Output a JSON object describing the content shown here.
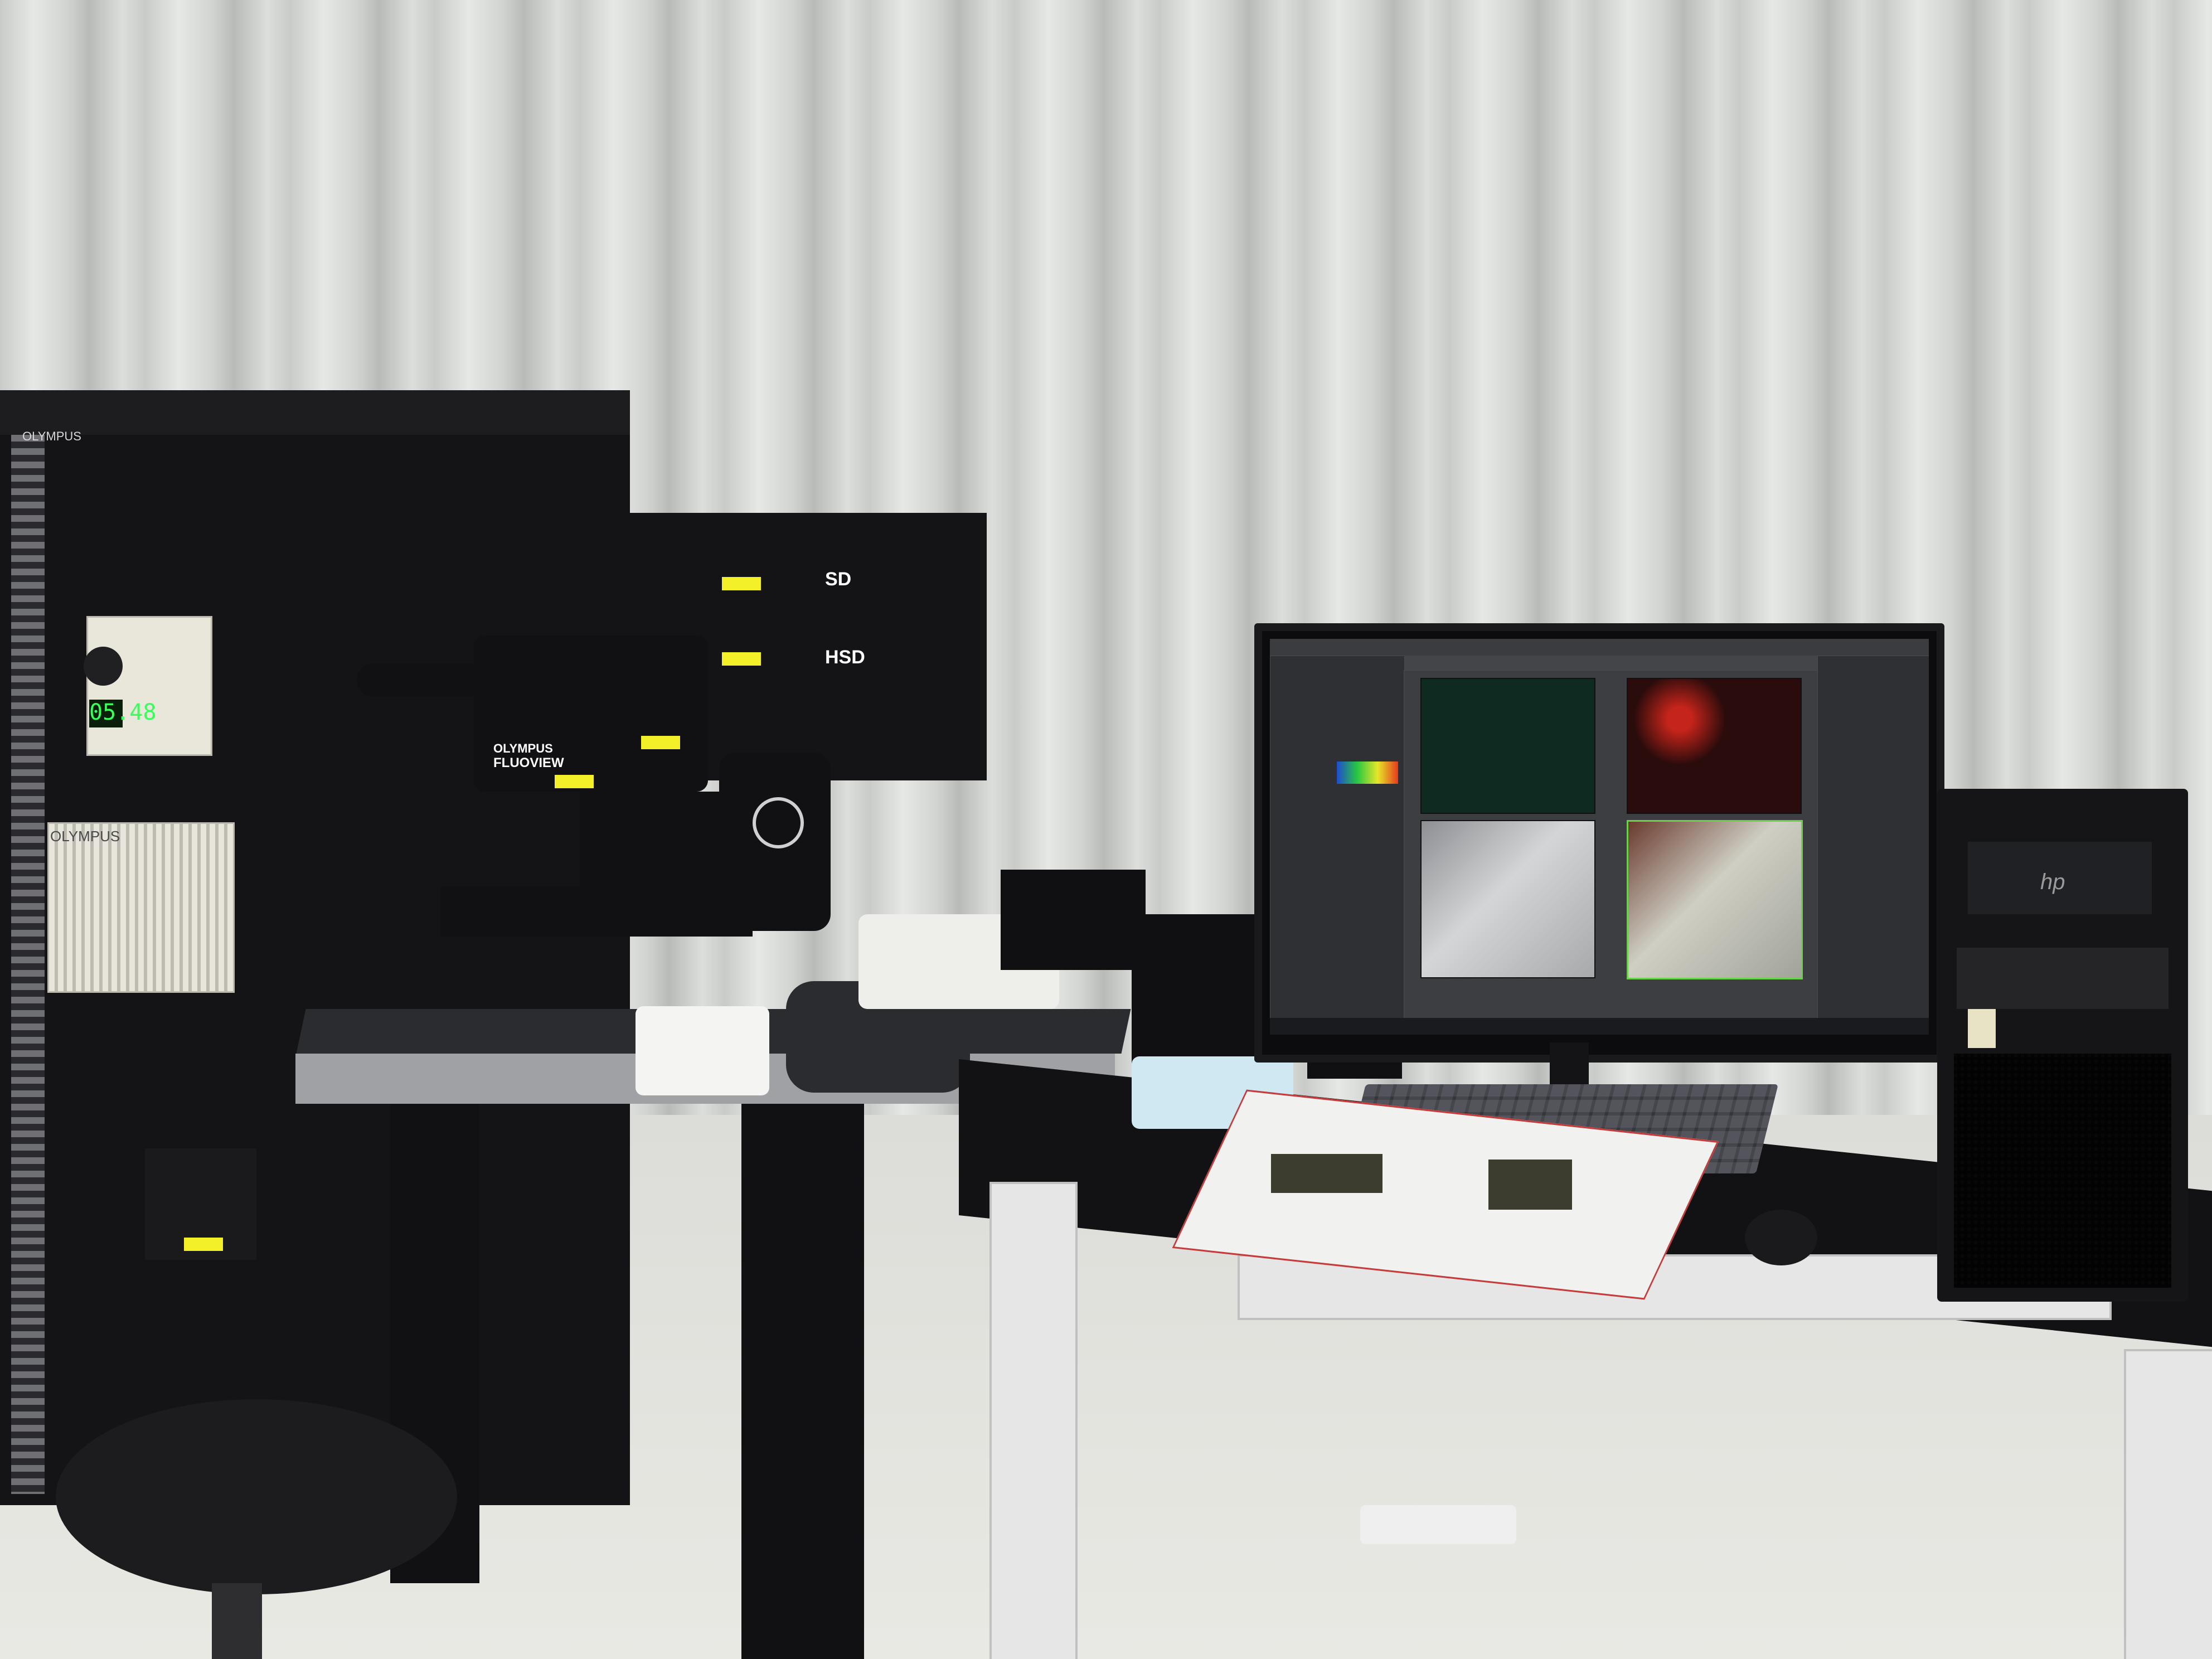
{
  "equipment": {
    "rack_brand": "OLYMPUS",
    "power_supply_brand": "OLYMPUS",
    "lcd_readout": "05.48",
    "scope_brand": "OLYMPUS",
    "scope_model": "FLUOVIEW",
    "scanner_labels": [
      "SD",
      "HSD"
    ],
    "pc_logo": "hp"
  },
  "monitor": {
    "software_panes": [
      {
        "kind": "fluorescence-green"
      },
      {
        "kind": "fluorescence-red"
      },
      {
        "kind": "brightfield"
      },
      {
        "kind": "overlay"
      }
    ]
  },
  "colors": {
    "curtain": "#d4d6d4",
    "equipment_black": "#141416",
    "warning_label": "#f3f02a",
    "screen_bg": "#2a2b2e",
    "green_channel": "#0f2a20",
    "red_channel": "#2a0c0c",
    "overlay_border": "#6bd04a"
  }
}
